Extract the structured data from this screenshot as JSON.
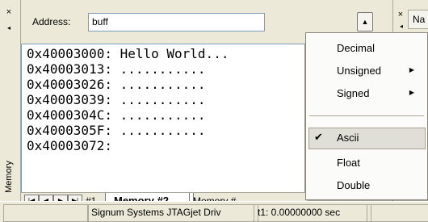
{
  "dock": {
    "title": "Memory",
    "close_glyph": "×",
    "pin_glyph": "◂"
  },
  "address": {
    "label": "Address:",
    "value": "buff",
    "scroll_up_glyph": "▲"
  },
  "memory_lines": [
    "0x40003000: Hello World...",
    "0x40003013: ...........",
    "0x40003026: ...........",
    "0x40003039: ...........",
    "0x4000304C: ...........",
    "0x4000305F: ...........",
    "0x40003072:"
  ],
  "tabs": {
    "nav": {
      "first": "|◀",
      "prev": "◀",
      "next": "▶",
      "last": "▶|"
    },
    "items": [
      "#1",
      "Memory #2",
      "Memory #"
    ]
  },
  "right_panel": {
    "close_glyph": "×",
    "pin_glyph": "◂",
    "column_header": "Na"
  },
  "menu": {
    "items": [
      {
        "label": "Decimal"
      },
      {
        "label": "Unsigned",
        "submenu": "▶"
      },
      {
        "label": "Signed",
        "submenu": "▶"
      },
      {
        "label": "Ascii",
        "checked": "✔"
      },
      {
        "label": "Float"
      },
      {
        "label": "Double"
      }
    ]
  },
  "status": {
    "target": "Signum Systems JTAGjet Driv",
    "time": "t1: 0.00000000 sec"
  }
}
